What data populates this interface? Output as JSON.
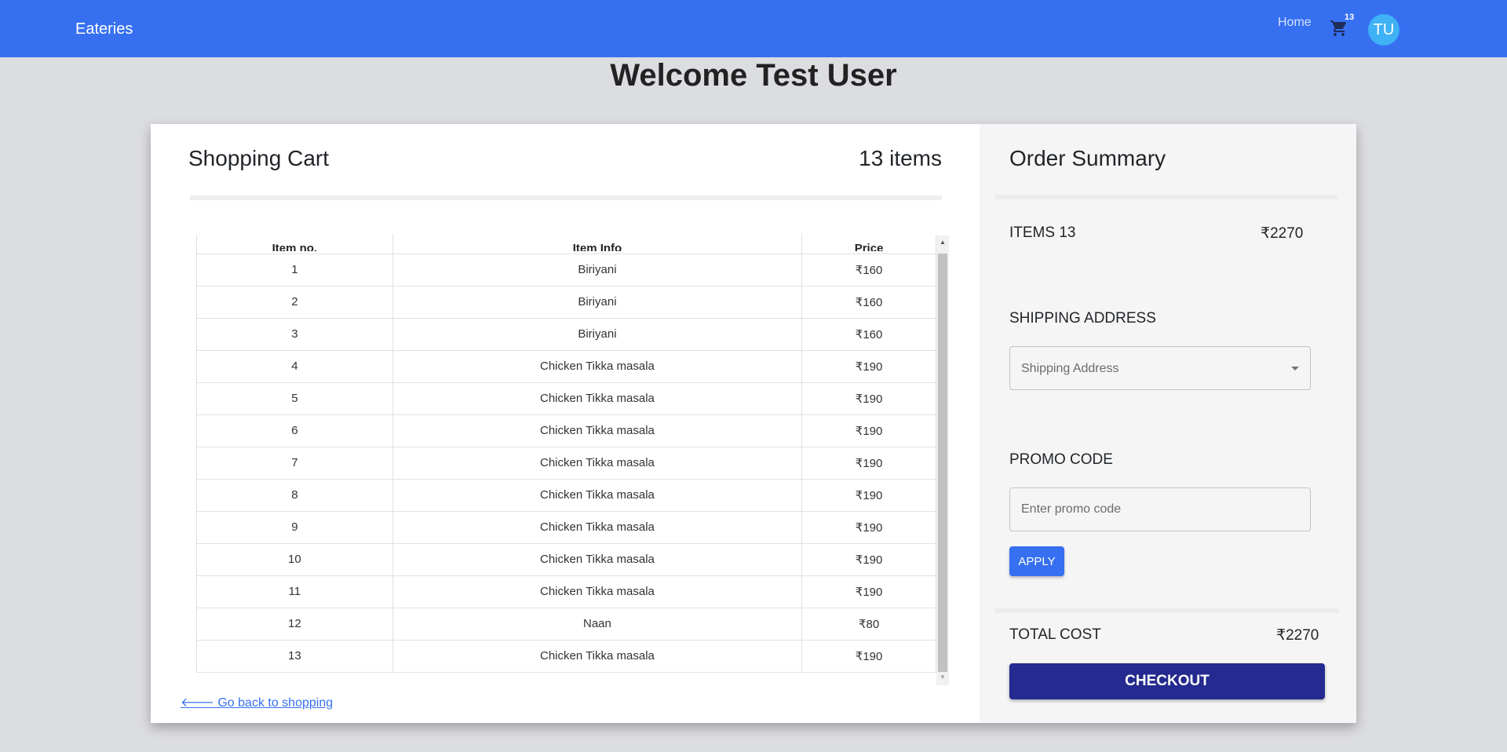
{
  "navbar": {
    "brand": "Eateries",
    "home": "Home",
    "cart_count": "13",
    "avatar_initials": "TU"
  },
  "welcome": "Welcome Test User",
  "cart": {
    "title": "Shopping Cart",
    "count_label": "13 items",
    "columns": [
      "Item no.",
      "Item Info",
      "Price"
    ],
    "rows": [
      {
        "no": "1",
        "info": "Biriyani",
        "price": "₹160"
      },
      {
        "no": "2",
        "info": "Biriyani",
        "price": "₹160"
      },
      {
        "no": "3",
        "info": "Biriyani",
        "price": "₹160"
      },
      {
        "no": "4",
        "info": "Chicken Tikka masala",
        "price": "₹190"
      },
      {
        "no": "5",
        "info": "Chicken Tikka masala",
        "price": "₹190"
      },
      {
        "no": "6",
        "info": "Chicken Tikka masala",
        "price": "₹190"
      },
      {
        "no": "7",
        "info": "Chicken Tikka masala",
        "price": "₹190"
      },
      {
        "no": "8",
        "info": "Chicken Tikka masala",
        "price": "₹190"
      },
      {
        "no": "9",
        "info": "Chicken Tikka masala",
        "price": "₹190"
      },
      {
        "no": "10",
        "info": "Chicken Tikka masala",
        "price": "₹190"
      },
      {
        "no": "11",
        "info": "Chicken Tikka masala",
        "price": "₹190"
      },
      {
        "no": "12",
        "info": "Naan",
        "price": "₹80"
      },
      {
        "no": "13",
        "info": "Chicken Tikka masala",
        "price": "₹190"
      }
    ],
    "back_link": " Go back to shopping"
  },
  "summary": {
    "title": "Order Summary",
    "items_label": "ITEMS 13",
    "items_value": "₹2270",
    "shipping_label": "SHIPPING ADDRESS",
    "shipping_placeholder": "Shipping Address",
    "promo_label": "PROMO CODE",
    "promo_placeholder": "Enter promo code",
    "apply": "APPLY",
    "total_label": "TOTAL COST",
    "total_value": "₹2270",
    "checkout": "CHECKOUT"
  },
  "colors": {
    "primary": "#3670f1",
    "checkout": "#242a8f",
    "avatar": "#3fb1f5"
  },
  "icons": [
    "cart-icon",
    "arrow-left-icon",
    "chevron-down-icon"
  ]
}
